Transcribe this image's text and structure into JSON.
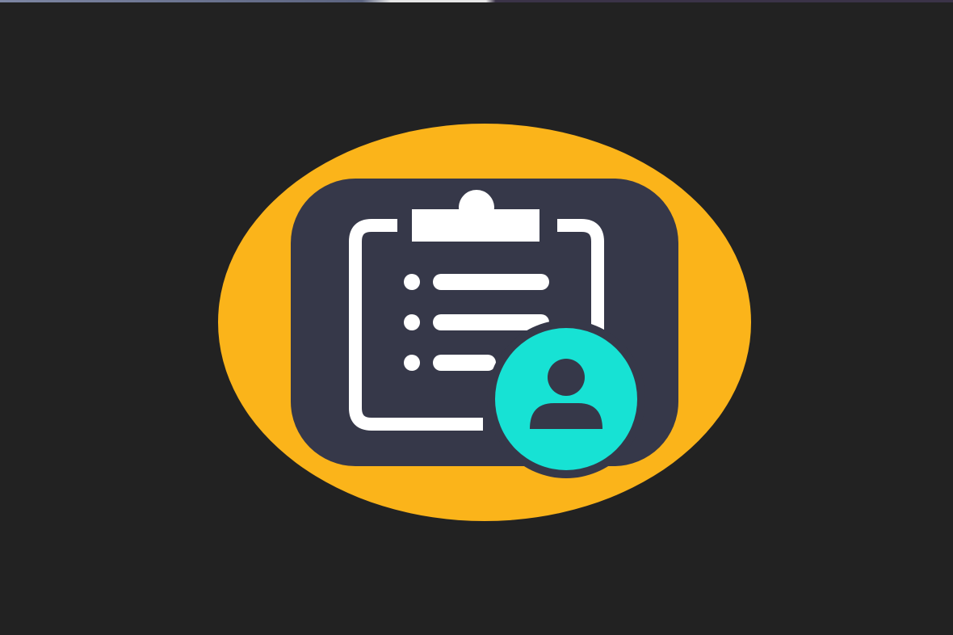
{
  "icon": {
    "name": "clipboard-user-icon",
    "colors": {
      "background": "#222222",
      "ring": "#FBB41A",
      "tile": "#363849",
      "clipboard": "#FFFFFF",
      "badge": "#17E2D4",
      "person": "#363849"
    }
  }
}
